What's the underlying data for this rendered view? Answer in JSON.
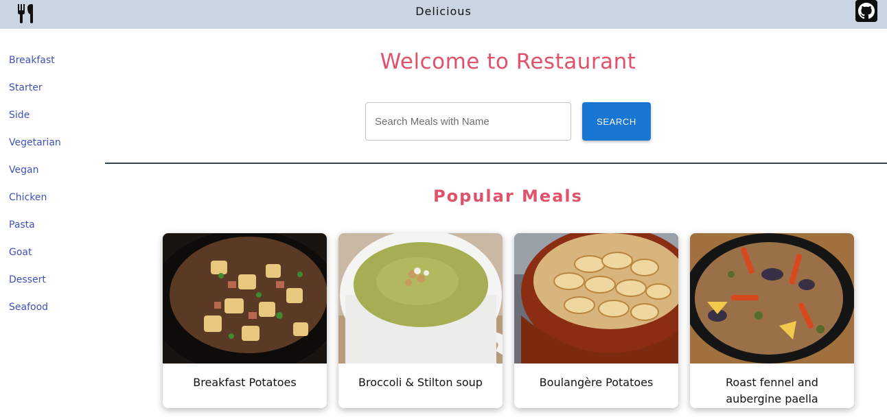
{
  "app": {
    "title": "Delicious"
  },
  "icons": {
    "logo": "fork-knife-icon",
    "github": "github-icon"
  },
  "sidebar": {
    "items": [
      {
        "label": "Breakfast"
      },
      {
        "label": "Starter"
      },
      {
        "label": "Side"
      },
      {
        "label": "Vegetarian"
      },
      {
        "label": "Vegan"
      },
      {
        "label": "Chicken"
      },
      {
        "label": "Pasta"
      },
      {
        "label": "Goat"
      },
      {
        "label": "Dessert"
      },
      {
        "label": "Seafood"
      }
    ]
  },
  "main": {
    "welcome": "Welcome to Restaurant",
    "search": {
      "placeholder": "Search Meals with Name",
      "value": "",
      "button_label": "SEARCH"
    },
    "popular_title": "Popular Meals",
    "meals": [
      {
        "name": "Breakfast Potatoes"
      },
      {
        "name": "Broccoli & Stilton soup"
      },
      {
        "name": "Boulangère Potatoes"
      },
      {
        "name": "Roast fennel and aubergine paella"
      }
    ]
  },
  "colors": {
    "topbar": "#cbd5e1",
    "accent": "#e0526b",
    "link": "#3f51b5",
    "button": "#1976d2",
    "divider": "#334155"
  }
}
